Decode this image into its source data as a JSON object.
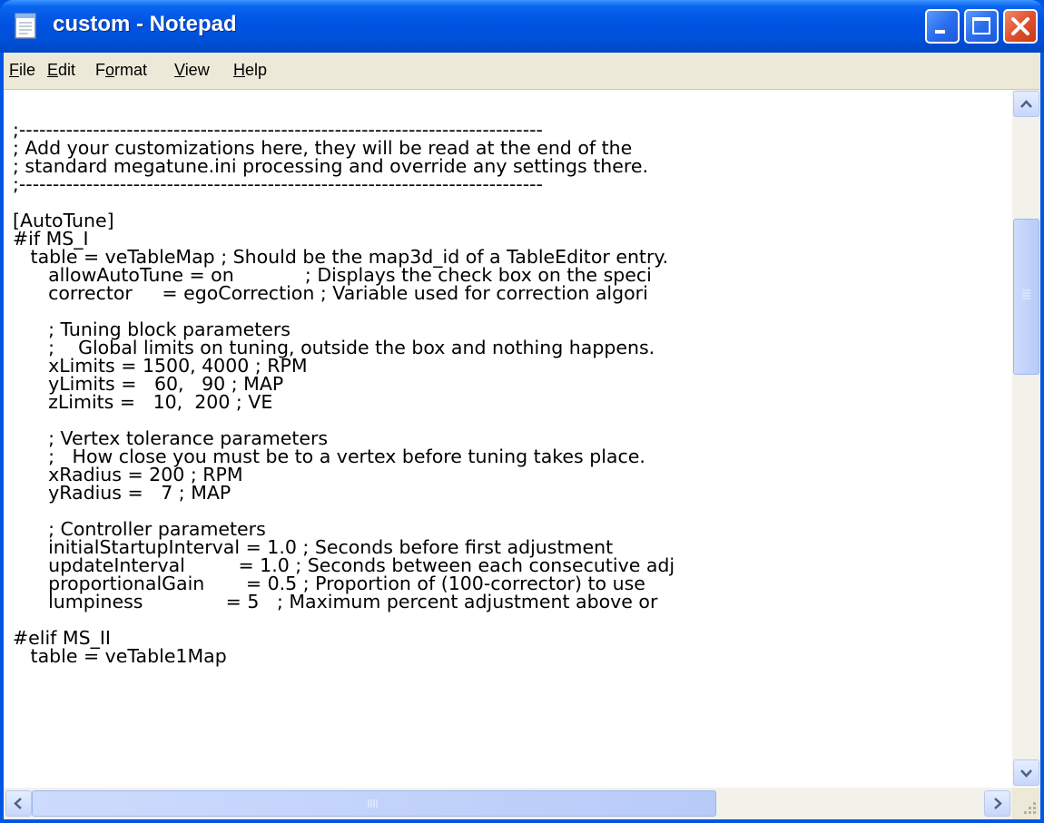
{
  "window": {
    "title": "custom - Notepad"
  },
  "menu": [
    {
      "pre": "",
      "key": "F",
      "post": "ile"
    },
    {
      "pre": "",
      "key": "E",
      "post": "dit"
    },
    {
      "pre": "F",
      "key": "o",
      "post": "rmat"
    },
    {
      "pre": "",
      "key": "V",
      "post": "iew"
    },
    {
      "pre": "",
      "key": "H",
      "post": "elp"
    }
  ],
  "document": {
    "lines": [
      ";------------------------------------------------------------------------------",
      "; Add your customizations here, they will be read at the end of the",
      "; standard megatune.ini processing and override any settings there.",
      ";------------------------------------------------------------------------------",
      "",
      "[AutoTune]",
      "#if MS_I",
      "   table = veTableMap ; Should be the map3d_id of a TableEditor entry.",
      "      allowAutoTune = on            ; Displays the check box on the speci",
      "      corrector     = egoCorrection ; Variable used for correction algori",
      "",
      "      ; Tuning block parameters",
      "      ;    Global limits on tuning, outside the box and nothing happens.",
      "      xLimits = 1500, 4000 ; RPM",
      "      yLimits =   60,   90 ; MAP",
      "      zLimits =   10,  200 ; VE",
      "",
      "      ; Vertex tolerance parameters",
      "      ;   How close you must be to a vertex before tuning takes place.",
      "      xRadius = 200 ; RPM",
      "      yRadius =   7 ; MAP",
      "",
      "      ; Controller parameters",
      "      initialStartupInterval = 1.0 ; Seconds before first adjustment",
      "      updateInterval         = 1.0 ; Seconds between each consecutive adj",
      "      proportionalGain       = 0.5 ; Proportion of (100-corrector) to use",
      "      lumpiness              = 5   ; Maximum percent adjustment above or",
      "",
      "#elif MS_II",
      "   table = veTable1Map"
    ]
  }
}
